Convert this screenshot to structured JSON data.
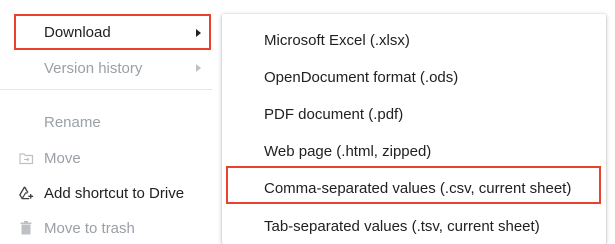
{
  "file_menu": {
    "items": [
      {
        "label": "Download",
        "has_submenu": true
      },
      {
        "label": "Version history",
        "has_submenu": true,
        "disabled": true
      },
      {
        "label": "Rename",
        "disabled": true
      },
      {
        "label": "Move",
        "icon": "folder-move-icon",
        "disabled": true
      },
      {
        "label": "Add shortcut to Drive",
        "icon": "add-shortcut-icon"
      },
      {
        "label": "Move to trash",
        "icon": "trash-icon",
        "disabled": true
      }
    ]
  },
  "download_submenu": {
    "items": [
      {
        "label": "Microsoft Excel (.xlsx)"
      },
      {
        "label": "OpenDocument format (.ods)"
      },
      {
        "label": "PDF document (.pdf)"
      },
      {
        "label": "Web page (.html, zipped)"
      },
      {
        "label": "Comma-separated values (.csv, current sheet)"
      },
      {
        "label": "Tab-separated values (.tsv, current sheet)"
      }
    ]
  },
  "highlight_color": "#e8412d"
}
